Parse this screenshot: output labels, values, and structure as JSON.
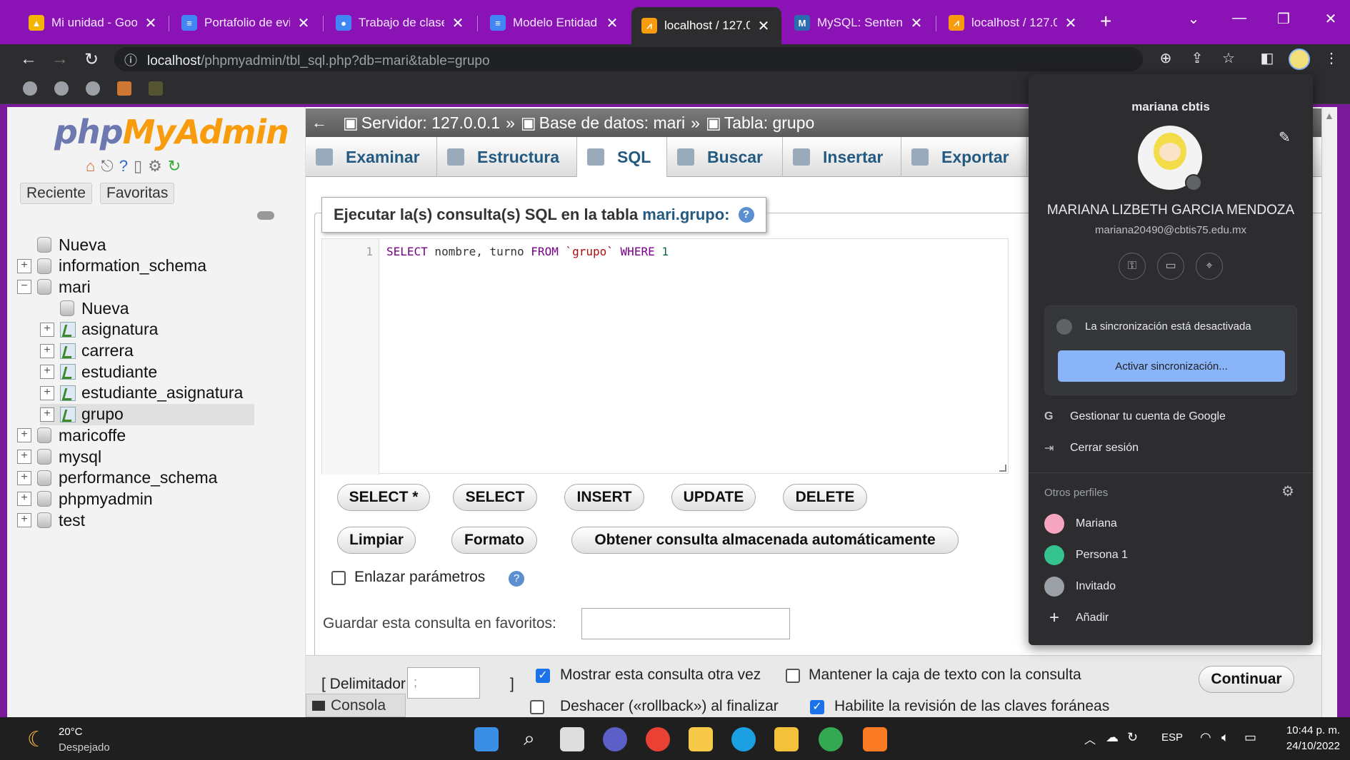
{
  "browser": {
    "tabs": [
      {
        "title": "Mi unidad - Goo",
        "icon": "drive-icon",
        "color": "#f4b400"
      },
      {
        "title": "Portafolio de evic",
        "icon": "docs-icon",
        "color": "#4285f4"
      },
      {
        "title": "Trabajo de clase",
        "icon": "classroom-icon",
        "color": "#4285f4"
      },
      {
        "title": "Modelo Entidad",
        "icon": "docs-icon",
        "color": "#4285f4"
      },
      {
        "title": "localhost / 127.0.",
        "icon": "phpmyadmin-icon",
        "color": "#f89c0e"
      },
      {
        "title": "MySQL: Sentenc",
        "icon": "mysql-icon",
        "color": "#2b6cb0"
      },
      {
        "title": "localhost / 127.0.",
        "icon": "phpmyadmin-icon",
        "color": "#f89c0e"
      }
    ],
    "url_host": "localhost",
    "url_path": "/phpmyadmin/tbl_sql.php?db=mari&table=grupo"
  },
  "pma": {
    "logo_php": "php",
    "logo_mya": "MyAdmin",
    "left_tabs": [
      "Reciente",
      "Favoritas"
    ],
    "tree": [
      {
        "label": "Nueva",
        "level": 0,
        "type": "new"
      },
      {
        "label": "information_schema",
        "level": 0,
        "type": "db"
      },
      {
        "label": "mari",
        "level": 0,
        "type": "db",
        "expanded": true
      },
      {
        "label": "Nueva",
        "level": 1,
        "type": "new"
      },
      {
        "label": "asignatura",
        "level": 1,
        "type": "table"
      },
      {
        "label": "carrera",
        "level": 1,
        "type": "table"
      },
      {
        "label": "estudiante",
        "level": 1,
        "type": "table"
      },
      {
        "label": "estudiante_asignatura",
        "level": 1,
        "type": "table"
      },
      {
        "label": "grupo",
        "level": 1,
        "type": "table",
        "selected": true
      },
      {
        "label": "maricoffe",
        "level": 0,
        "type": "db"
      },
      {
        "label": "mysql",
        "level": 0,
        "type": "db"
      },
      {
        "label": "performance_schema",
        "level": 0,
        "type": "db"
      },
      {
        "label": "phpmyadmin",
        "level": 0,
        "type": "db"
      },
      {
        "label": "test",
        "level": 0,
        "type": "db"
      }
    ],
    "breadcrumb": {
      "server": "Servidor: 127.0.0.1",
      "database": "Base de datos: mari",
      "table": "Tabla: grupo"
    },
    "menu_tabs": [
      "Examinar",
      "Estructura",
      "SQL",
      "Buscar",
      "Insertar",
      "Exportar"
    ],
    "active_tab": "SQL",
    "legend_prefix": "Ejecutar la(s) consulta(s) SQL en la tabla",
    "legend_table": "mari.grupo:",
    "line_number": "1",
    "query_parts": {
      "k1": "SELECT",
      "t1": " nombre, turno ",
      "k2": "FROM",
      "t2": " ",
      "s1": "`grupo`",
      "t3": " ",
      "k3": "WHERE",
      "t4": " ",
      "n1": "1"
    },
    "buttons_row1": [
      "SELECT *",
      "SELECT",
      "INSERT",
      "UPDATE",
      "DELETE"
    ],
    "buttons_row2": [
      "Limpiar",
      "Formato",
      "Obtener consulta almacenada automáticamente"
    ],
    "bind_params": "Enlazar parámetros",
    "save_label": "Guardar esta consulta en favoritos:",
    "delimiter_label": "[ Delimitador",
    "delimiter_value": ";",
    "delimiter_close": "]",
    "show_again": "Mostrar esta consulta otra vez",
    "keep_box": "Mantener la caja de texto con la consulta",
    "rollback": "Deshacer («rollback») al finalizar",
    "foreign_keys": "Habilite la revisión de las claves foráneas",
    "continue": "Continuar",
    "console": "Consola"
  },
  "profile": {
    "top_name": "mariana cbtis",
    "full_name": "MARIANA LIZBETH GARCIA MENDOZA",
    "email": "mariana20490@cbtis75.edu.mx",
    "sync_status": "La sincronización está desactivada",
    "sync_button": "Activar sincronización...",
    "manage_account": "Gestionar tu cuenta de Google",
    "sign_out": "Cerrar sesión",
    "other_profiles": "Otros perfiles",
    "profiles": [
      {
        "name": "Mariana",
        "color": "#f6a5c0"
      },
      {
        "name": "Persona 1",
        "color": "#34c38f"
      },
      {
        "name": "Invitado",
        "color": "#9aa0a6"
      }
    ],
    "add": "Añadir"
  },
  "taskbar": {
    "temp": "20°C",
    "weather": "Despejado",
    "lang": "ESP",
    "time": "10:44 p. m.",
    "date": "24/10/2022"
  }
}
